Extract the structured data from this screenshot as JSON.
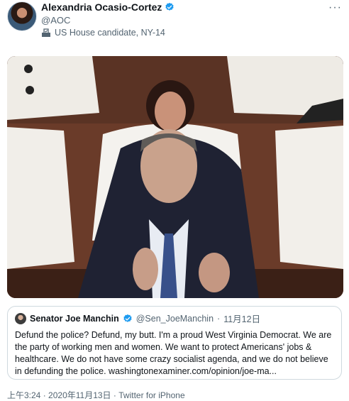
{
  "tweet": {
    "author_name": "Alexandria Ocasio-Cortez",
    "author_handle": "@AOC",
    "candidate_label": "US House candidate, NY-14",
    "more_icon": "···"
  },
  "quoted_tweet": {
    "author_name": "Senator Joe Manchin",
    "author_handle": "@Sen_JoeManchin",
    "separator": "·",
    "date": "11月12日",
    "text": "Defund the police? Defund, my butt. I'm a proud West Virginia Democrat. We are the party of working men and women. We want to protect Americans' jobs & healthcare. We do not have some crazy socialist agenda, and we do not believe in defunding the police. washingtonexaminer.com/opinion/joe-ma..."
  },
  "footer": {
    "time": "上午3:24",
    "sep1": "·",
    "date": "2020年11月13日",
    "sep2": "·",
    "source": "Twitter for iPhone"
  },
  "colors": {
    "verified": "#1d9bf0",
    "secondary_text": "#536471",
    "border": "#cfd9de"
  },
  "icons": {
    "verified": "verified-badge-icon",
    "ballot": "ballot-box-icon",
    "more": "more-options-icon"
  }
}
